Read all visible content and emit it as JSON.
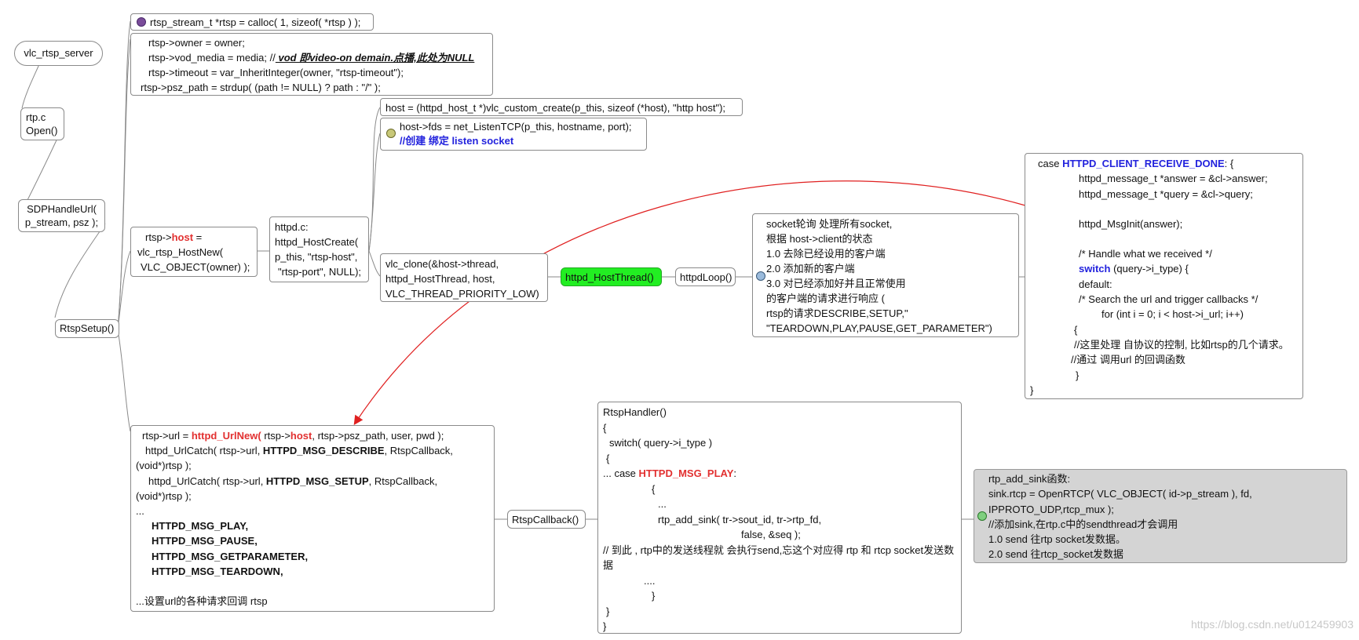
{
  "nodes": {
    "server": "vlc_rtsp_server",
    "rtp_c": "rtp.c",
    "open": "Open()",
    "sdp_line1": "SDPHandleUrl(",
    "sdp_line2": "p_stream, psz );",
    "rtsp_setup": "RtspSetup()",
    "rtsp_callback": "RtspCallback()",
    "host_thread": "httpd_HostThread()",
    "httpd_loop": "httpdLoop()"
  },
  "calloc_box": "rtsp_stream_t *rtsp = calloc( 1, sizeof( *rtsp ) );",
  "owner_box": {
    "l1": "rtsp->owner = owner;",
    "l2a": "rtsp->vod_media = media; //",
    "l2b": " vod 即video-on demain.点播,此处为NULL",
    "l3": "rtsp->timeout = var_InheritInteger(owner, \"rtsp-timeout\");",
    "l4": "rtsp->psz_path = strdup( (path != NULL) ? path : \"/\" );"
  },
  "hostnew_box": {
    "l1a": "rtsp->",
    "l1b": "host",
    "l1c": " =",
    "l2": "vlc_rtsp_HostNew(",
    "l3": "VLC_OBJECT(owner) );"
  },
  "hostcreate_box": {
    "l1": "httpd.c:",
    "l2": "httpd_HostCreate(",
    "l3": "p_this, \"rtsp-host\",",
    "l4": "\"rtsp-port\", NULL);"
  },
  "host_alloc_box": "host = (httpd_host_t *)vlc_custom_create(p_this, sizeof (*host), \"http host\");",
  "listen_box": {
    "l1": "host->fds = net_ListenTCP(p_this, hostname, port);",
    "l2": "//创建 绑定 listen socket"
  },
  "clone_box": {
    "l1": "vlc_clone(&host->thread,",
    "l2": "httpd_HostThread, host,",
    "l3": "VLC_THREAD_PRIORITY_LOW)"
  },
  "poll_box": {
    "l1": "socket轮询 处理所有socket,",
    "l2": "根据 host->client的状态",
    "l3": "1.0 去除已经设用的客户端",
    "l4": "2.0 添加新的客户端",
    "l5": "3.0 对已经添加好并且正常使用",
    "l6": "的客户端的请求进行响应 (",
    "l7": "rtsp的请求DESCRIBE,SETUP,\"",
    "l8": "\"TEARDOWN,PLAY,PAUSE,GET_PARAMETER\")"
  },
  "receive_box": {
    "l1a": "case ",
    "l1b": "HTTPD_CLIENT_RECEIVE_DONE",
    "l1c": ": {",
    "l2": "httpd_message_t *answer = &cl->answer;",
    "l3": "httpd_message_t *query  = &cl->query;",
    "l4": "httpd_MsgInit(answer);",
    "l5": "/* Handle what we received */",
    "l6a": "switch",
    "l6b": "  (query->i_type) {",
    "l7": "default:",
    "l8": "/* Search the url and trigger callbacks */",
    "l9": "for (int i = 0; i < host->i_url; i++)",
    "l10": "{",
    "l11": "//这里处理 自协议的控制, 比如rtsp的几个请求。",
    "l12": "//通过 调用url 的回调函数",
    "l13": "}",
    "l14": "}"
  },
  "urlnew_box": {
    "l1a": "rtsp->url = ",
    "l1b": "httpd_UrlNew(",
    "l1c": " rtsp->",
    "l1d": "host",
    "l1e": ", rtsp->psz_path, user, pwd );",
    "l2a": "httpd_UrlCatch( rtsp->url, ",
    "l2b": "HTTPD_MSG_DESCRIBE",
    "l2c": ", RtspCallback,",
    "l3": "(void*)rtsp );",
    "l4a": "httpd_UrlCatch( rtsp->url, ",
    "l4b": "HTTPD_MSG_SETUP",
    "l4c": ",    RtspCallback,",
    "l5": "(void*)rtsp );",
    "l6": "...",
    "l7": "HTTPD_MSG_PLAY,",
    "l8": "HTTPD_MSG_PAUSE,",
    "l9": "HTTPD_MSG_GETPARAMETER,",
    "l10": "HTTPD_MSG_TEARDOWN,",
    "l11": "...设置url的各种请求回调 rtsp"
  },
  "handler_box": {
    "l1": "RtspHandler()",
    "l2": "{",
    "l3": "switch( query->i_type )",
    "l4": "{",
    "l5a": "...     case ",
    "l5b": "HTTPD_MSG_PLAY",
    "l5c": ":",
    "l6": "{",
    "l7": "...",
    "l8": "rtp_add_sink( tr->sout_id, tr->rtp_fd,",
    "l9": "false, &seq );",
    "l10": "// 到此 , rtp中的发送线程就 会执行send,忘这个对应得 rtp 和 rtcp socket发送数据",
    "l11": "....",
    "l12": "}",
    "l13": "}",
    "l14": "}"
  },
  "sink_box": {
    "l1": "rtp_add_sink函数:",
    "l2": "sink.rtcp = OpenRTCP( VLC_OBJECT( id->p_stream ), fd,",
    "l3": "IPPROTO_UDP,rtcp_mux );",
    "l4": "//添加sink,在rtp.c中的sendthread才会调用",
    "l5": "1.0 send 往rtp socket发数据。",
    "l6": "2.0 send 往rtcp_socket发数据"
  },
  "watermark": "https://blog.csdn.net/u012459903",
  "colors": {
    "keyword_blue": "#2222dd",
    "keyword_red": "#e23030",
    "thread_green": "#22ee22",
    "sink_gray": "#d4d4d4",
    "arrow_red": "#e02020"
  }
}
